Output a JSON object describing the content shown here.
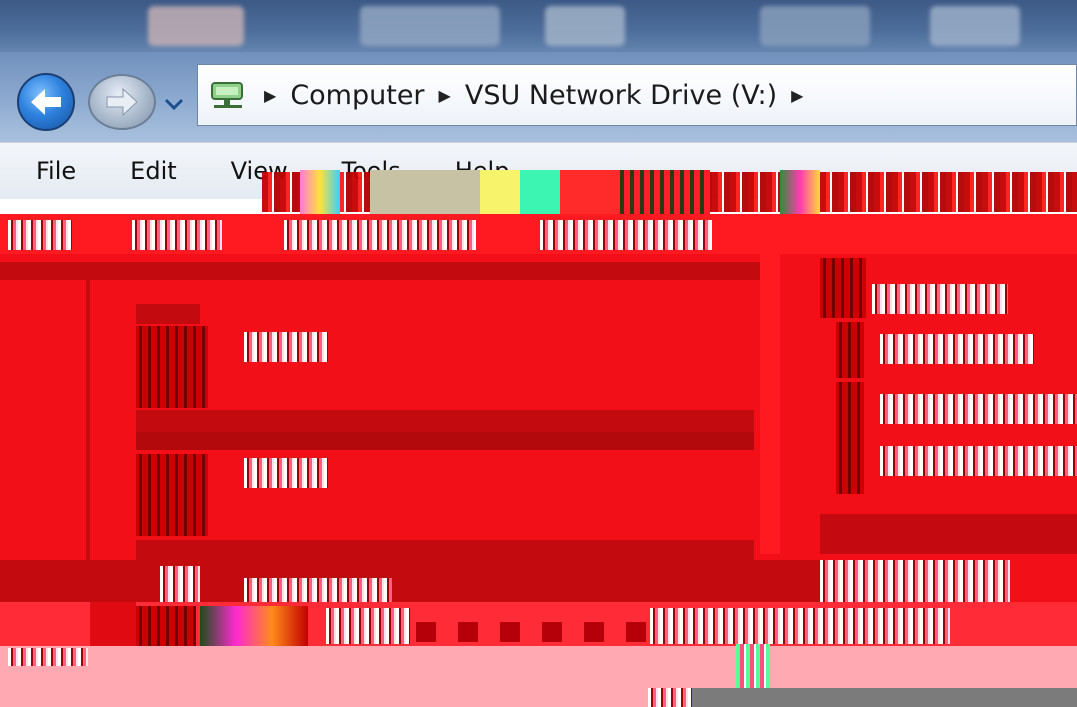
{
  "nav": {
    "back_icon": "back-arrow-icon",
    "forward_icon": "forward-arrow-icon",
    "recent_icon": "chevron-down-icon",
    "address": {
      "drive_icon": "network-drive-icon",
      "crumbs": [
        "Computer",
        "VSU Network Drive (V:)"
      ],
      "separator_icon": "breadcrumb-arrow-icon"
    }
  },
  "menu": {
    "items": [
      "File",
      "Edit",
      "View",
      "Tools",
      "Help"
    ]
  },
  "colors": {
    "corrupt_red": "#f20f17",
    "corrupt_dark_red": "#c20a0f",
    "corrupt_pink": "#ffa9b2",
    "titlebar_blue": "#4f6f9c"
  }
}
